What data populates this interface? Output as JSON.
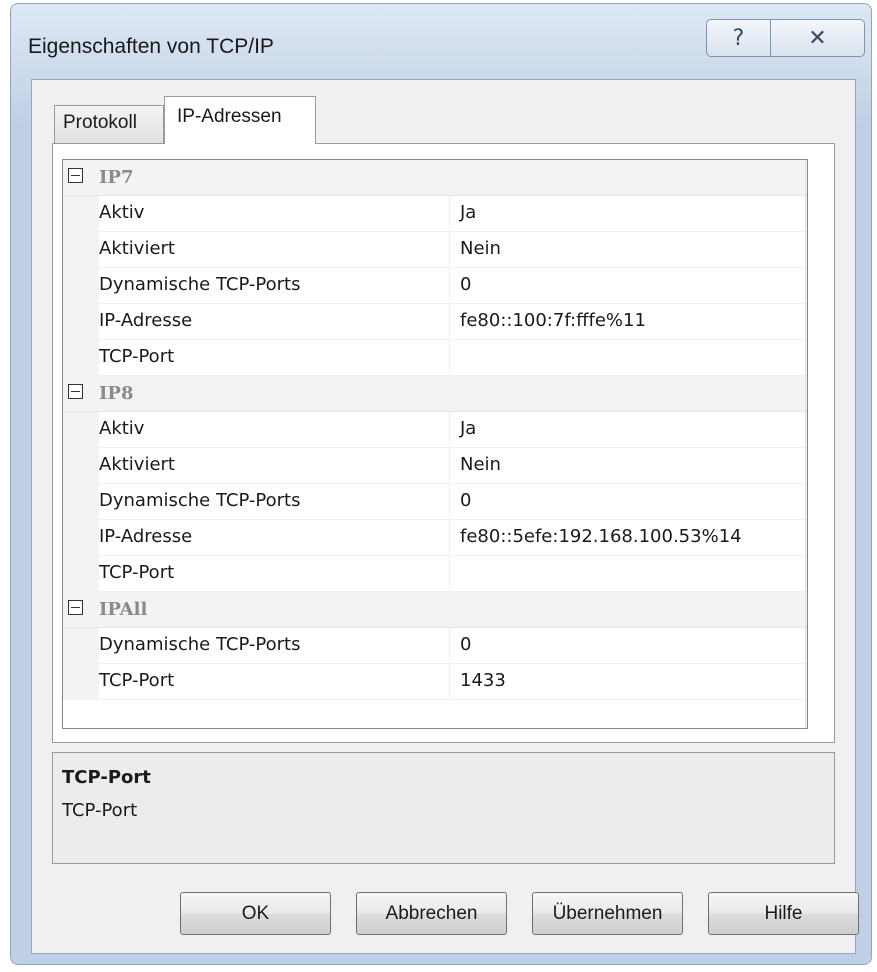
{
  "window": {
    "title": "Eigenschaften von TCP/IP",
    "help_glyph": "?",
    "close_glyph": "✕"
  },
  "tabs": [
    {
      "label": "Protokoll",
      "active": false
    },
    {
      "label": "IP-Adressen",
      "active": true
    }
  ],
  "grid": {
    "categories": [
      {
        "label": "IP7",
        "rows": [
          {
            "name": "Aktiv",
            "value": "Ja"
          },
          {
            "name": "Aktiviert",
            "value": "Nein"
          },
          {
            "name": "Dynamische TCP-Ports",
            "value": "0"
          },
          {
            "name": "IP-Adresse",
            "value": "fe80::100:7f:fffe%11"
          },
          {
            "name": "TCP-Port",
            "value": ""
          }
        ]
      },
      {
        "label": "IP8",
        "rows": [
          {
            "name": "Aktiv",
            "value": "Ja"
          },
          {
            "name": "Aktiviert",
            "value": "Nein"
          },
          {
            "name": "Dynamische TCP-Ports",
            "value": "0"
          },
          {
            "name": "IP-Adresse",
            "value": "fe80::5efe:192.168.100.53%14"
          },
          {
            "name": "TCP-Port",
            "value": ""
          }
        ]
      },
      {
        "label": "IPAll",
        "rows": [
          {
            "name": "Dynamische TCP-Ports",
            "value": "0"
          },
          {
            "name": "TCP-Port",
            "value": "1433"
          }
        ]
      }
    ]
  },
  "scrollbar": {
    "up_glyph": "▲",
    "down_glyph": "▼"
  },
  "description": {
    "title": "TCP-Port",
    "text": "TCP-Port"
  },
  "buttons": {
    "ok": "OK",
    "cancel": "Abbrechen",
    "apply": "Übernehmen",
    "help": "Hilfe"
  }
}
